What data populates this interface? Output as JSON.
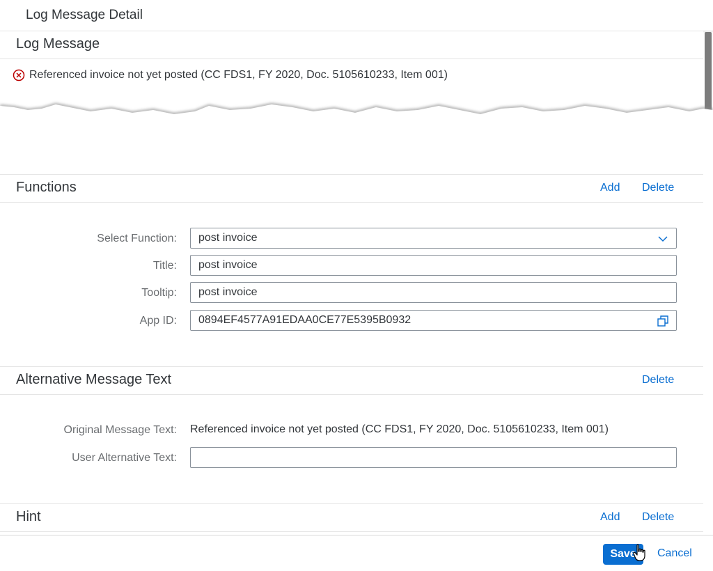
{
  "dialog": {
    "title": "Log Message Detail"
  },
  "log_message": {
    "section_title": "Log Message",
    "error_icon": "error-circle-icon",
    "text": "Referenced invoice not yet posted (CC FDS1, FY 2020, Doc. 5105610233, Item 001)"
  },
  "functions": {
    "section_title": "Functions",
    "add_label": "Add",
    "delete_label": "Delete",
    "select_function": {
      "label": "Select Function:",
      "value": "post invoice",
      "icon": "chevron-down-icon"
    },
    "title": {
      "label": "Title:",
      "value": "post invoice"
    },
    "tooltip": {
      "label": "Tooltip:",
      "value": "post invoice"
    },
    "app_id": {
      "label": "App ID:",
      "value": "0894EF4577A91EDAA0CE77E5395B0932",
      "icon": "value-help-icon"
    }
  },
  "alt_message": {
    "section_title": "Alternative Message Text",
    "delete_label": "Delete",
    "original": {
      "label": "Original Message Text:",
      "value": "Referenced invoice not yet posted (CC FDS1, FY 2020, Doc. 5105610233, Item 001)"
    },
    "user_alt": {
      "label": "User Alternative Text:",
      "value": ""
    }
  },
  "hint": {
    "section_title": "Hint",
    "add_label": "Add",
    "delete_label": "Delete"
  },
  "footer": {
    "save_label": "Save",
    "cancel_label": "Cancel"
  },
  "colors": {
    "accent": "#0a6ed1",
    "error": "#bb0000",
    "text": "#32363a",
    "label": "#6a6d70"
  }
}
